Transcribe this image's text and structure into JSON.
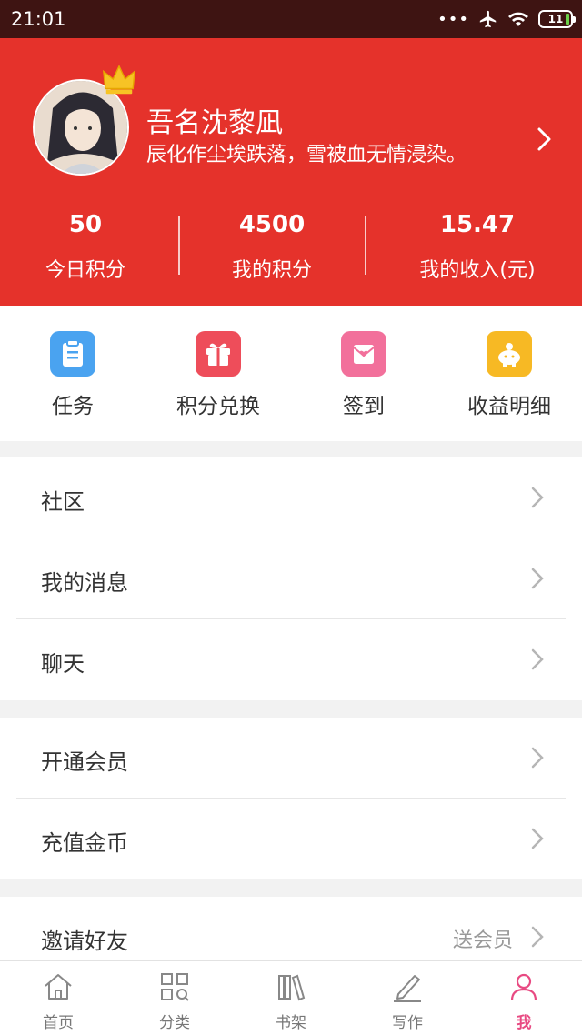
{
  "status_bar": {
    "time": "21:01",
    "battery": "11"
  },
  "profile": {
    "name": "吾名沈黎凪",
    "bio": "辰化作尘埃跌落，雪被血无情浸染。"
  },
  "stats": [
    {
      "value": "50",
      "label": "今日积分"
    },
    {
      "value": "4500",
      "label": "我的积分"
    },
    {
      "value": "15.47",
      "label": "我的收入(元)"
    }
  ],
  "quick_actions": [
    {
      "label": "任务",
      "icon": "task-icon",
      "color": "#4aa3f0"
    },
    {
      "label": "积分兑换",
      "icon": "gift-icon",
      "color": "#ee4d5a"
    },
    {
      "label": "签到",
      "icon": "checkin-icon",
      "color": "#f2709b"
    },
    {
      "label": "收益明细",
      "icon": "piggy-bank-icon",
      "color": "#f7b924"
    }
  ],
  "menu": {
    "group1": [
      {
        "label": "社区"
      },
      {
        "label": "我的消息"
      },
      {
        "label": "聊天"
      }
    ],
    "group2": [
      {
        "label": "开通会员"
      },
      {
        "label": "充值金币"
      }
    ],
    "group3": [
      {
        "label": "邀请好友",
        "extra": "送会员"
      }
    ]
  },
  "tabs": [
    {
      "label": "首页",
      "icon": "home-icon"
    },
    {
      "label": "分类",
      "icon": "category-icon"
    },
    {
      "label": "书架",
      "icon": "bookshelf-icon"
    },
    {
      "label": "写作",
      "icon": "pen-icon"
    },
    {
      "label": "我",
      "icon": "person-icon",
      "active": true
    }
  ],
  "colors": {
    "brand_red": "#e5322b",
    "active_tab": "#e84a82"
  }
}
